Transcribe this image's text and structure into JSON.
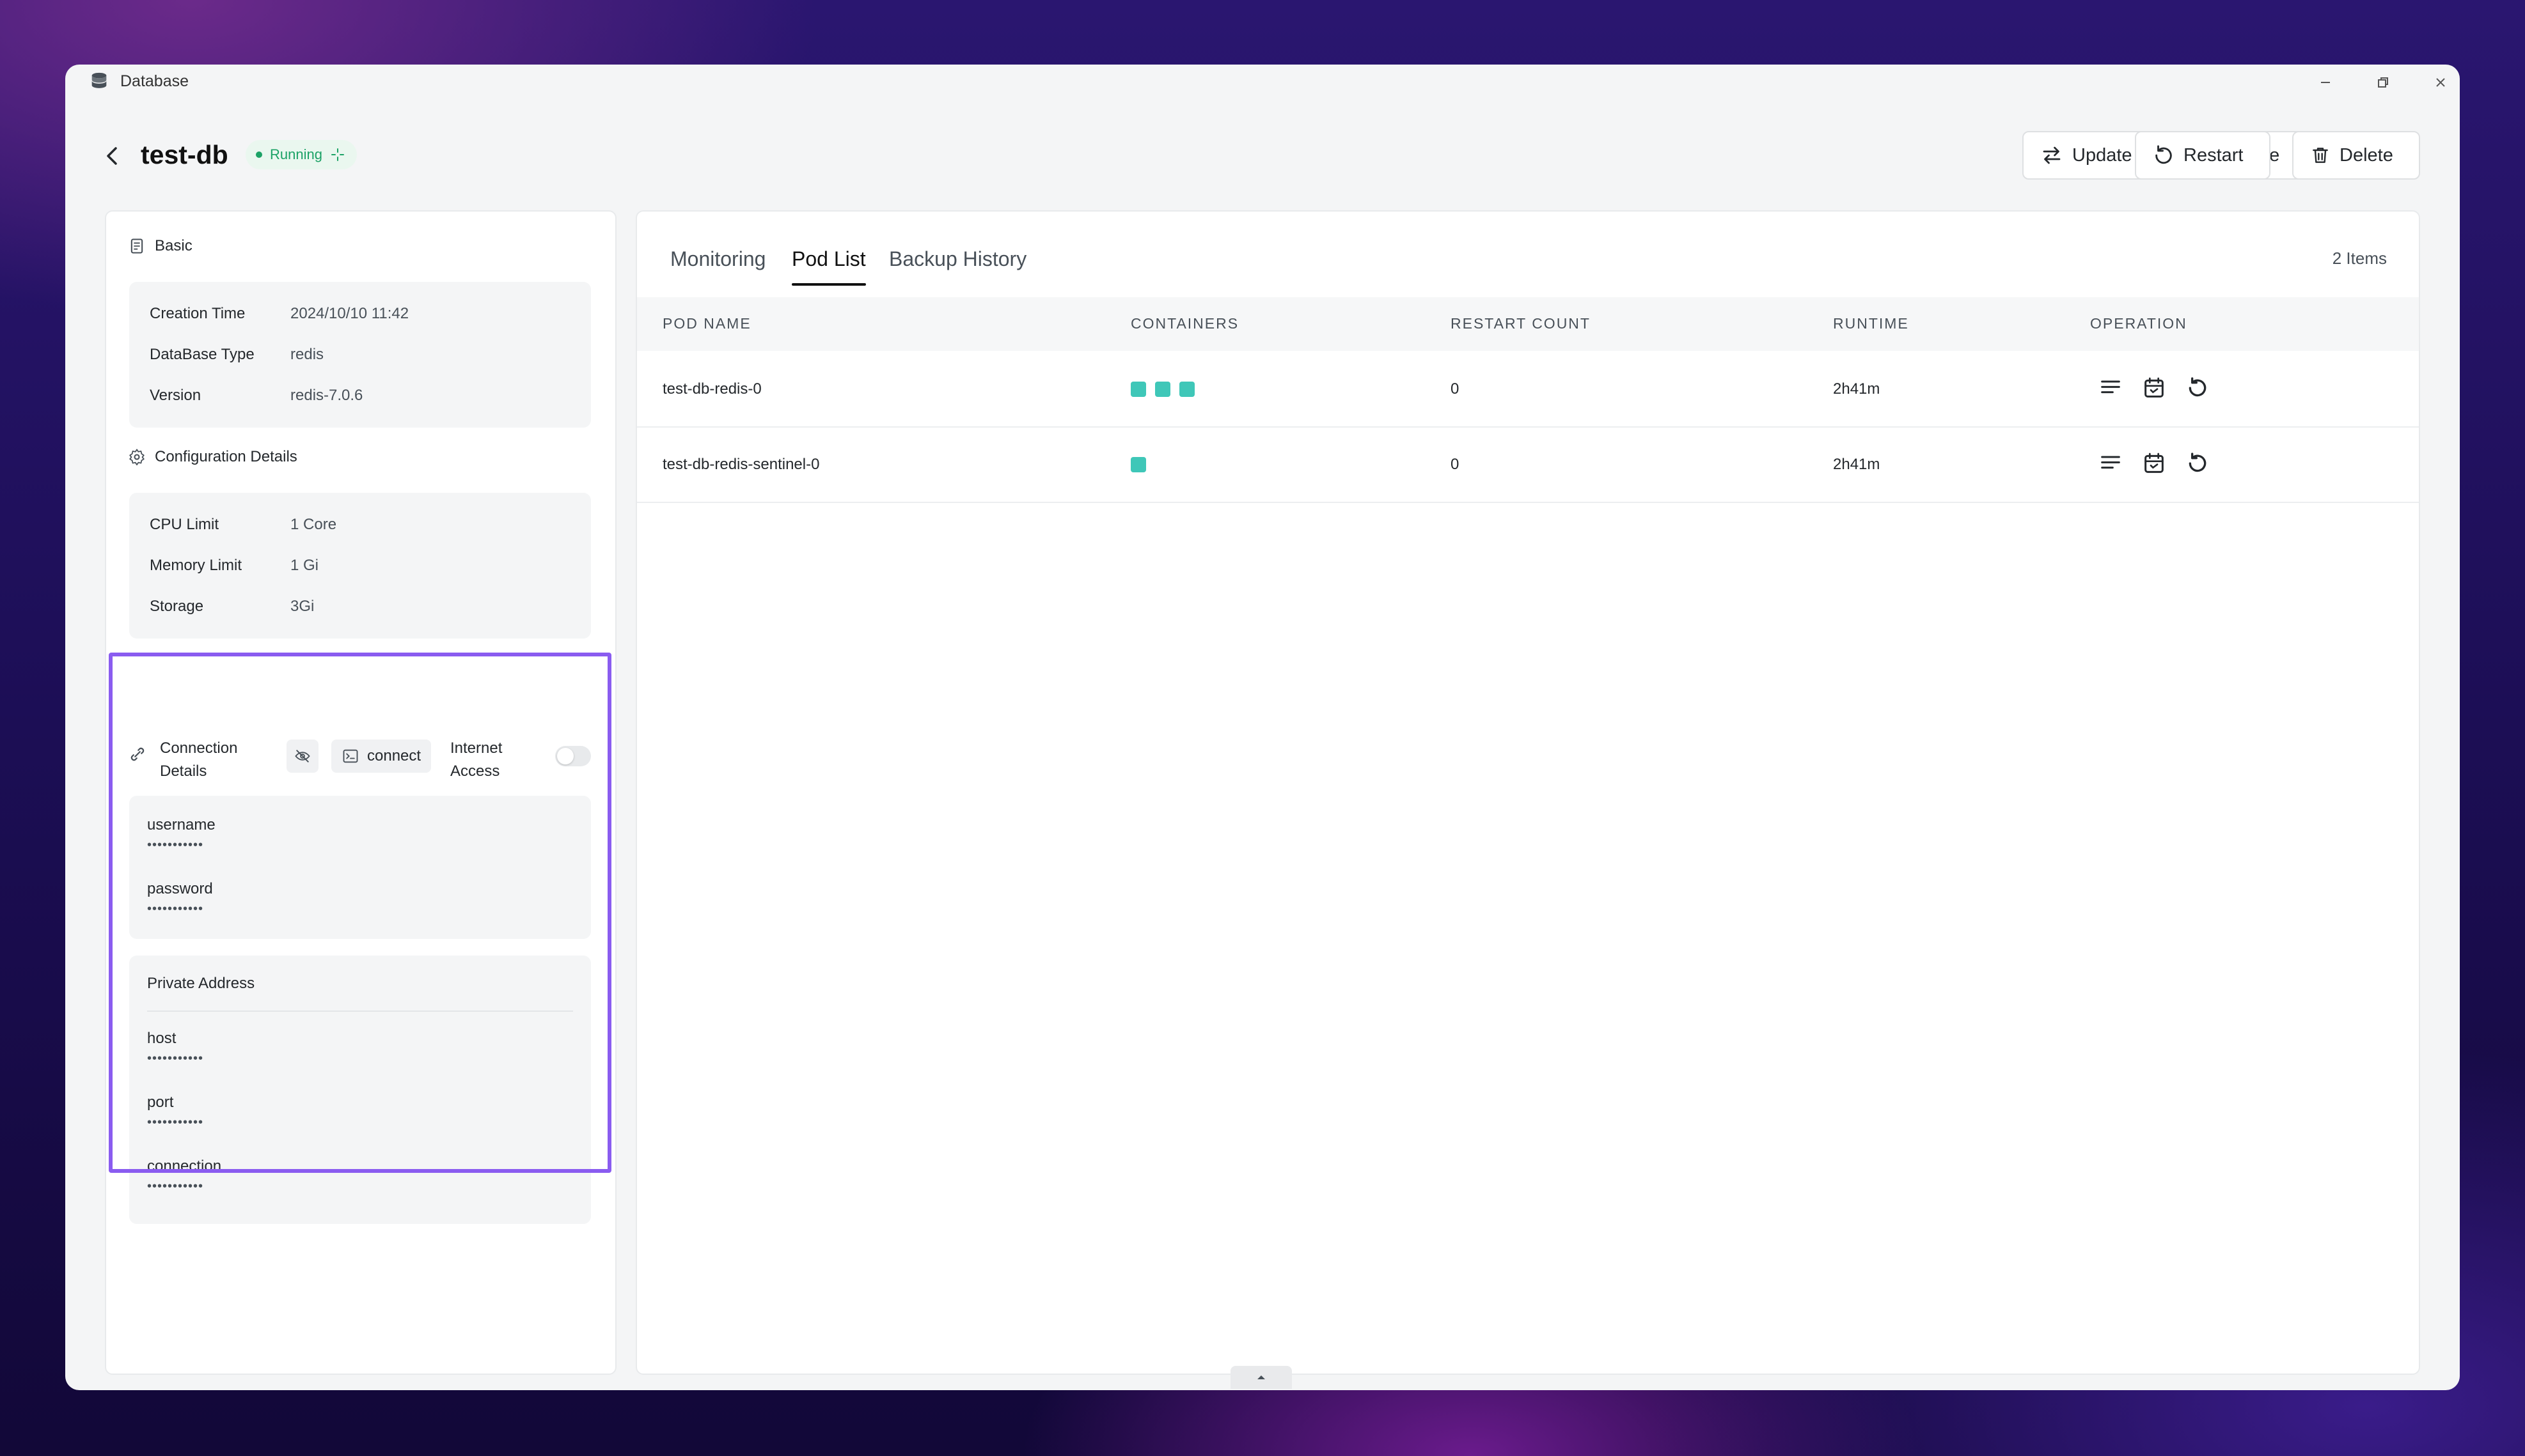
{
  "window": {
    "app_title": "Database",
    "app_icon": "database-icon"
  },
  "header": {
    "db_name": "test-db",
    "status": "Running",
    "buttons": {
      "update": "Update",
      "pause": "Pause",
      "restart": "Restart",
      "delete": "Delete"
    }
  },
  "basic": {
    "title": "Basic",
    "rows": [
      {
        "key": "Creation Time",
        "value": "2024/10/10 11:42"
      },
      {
        "key": "DataBase Type",
        "value": "redis"
      },
      {
        "key": "Version",
        "value": "redis-7.0.6"
      }
    ]
  },
  "config": {
    "title": "Configuration Details",
    "rows": [
      {
        "key": "CPU Limit",
        "value": "1 Core"
      },
      {
        "key": "Memory Limit",
        "value": "1 Gi"
      },
      {
        "key": "Storage",
        "value": "3Gi"
      }
    ]
  },
  "connection": {
    "title_line1": "Connection",
    "title_line2": "Details",
    "connect_label": "connect",
    "internet_line1": "Internet",
    "internet_line2": "Access",
    "credentials": [
      {
        "label": "username",
        "value": "•••••••••••"
      },
      {
        "label": "password",
        "value": "•••••••••••"
      }
    ],
    "private_address_title": "Private Address",
    "address": [
      {
        "label": "host",
        "value": "•••••••••••"
      },
      {
        "label": "port",
        "value": "•••••••••••"
      },
      {
        "label": "connection",
        "value": "•••••••••••"
      }
    ]
  },
  "tabs": [
    "Monitoring",
    "Pod List",
    "Backup History"
  ],
  "active_tab": "Pod List",
  "items_count": "2 Items",
  "table": {
    "headers": [
      "POD NAME",
      "CONTAINERS",
      "RESTART COUNT",
      "RUNTIME",
      "OPERATION"
    ],
    "rows": [
      {
        "name": "test-db-redis-0",
        "containers": 3,
        "restart_count": "0",
        "runtime": "2h41m"
      },
      {
        "name": "test-db-redis-sentinel-0",
        "containers": 1,
        "restart_count": "0",
        "runtime": "2h41m"
      }
    ]
  },
  "colors": {
    "accent_highlight": "#8a5cf0",
    "running": "#1ca266",
    "container": "#3fc7b8"
  }
}
